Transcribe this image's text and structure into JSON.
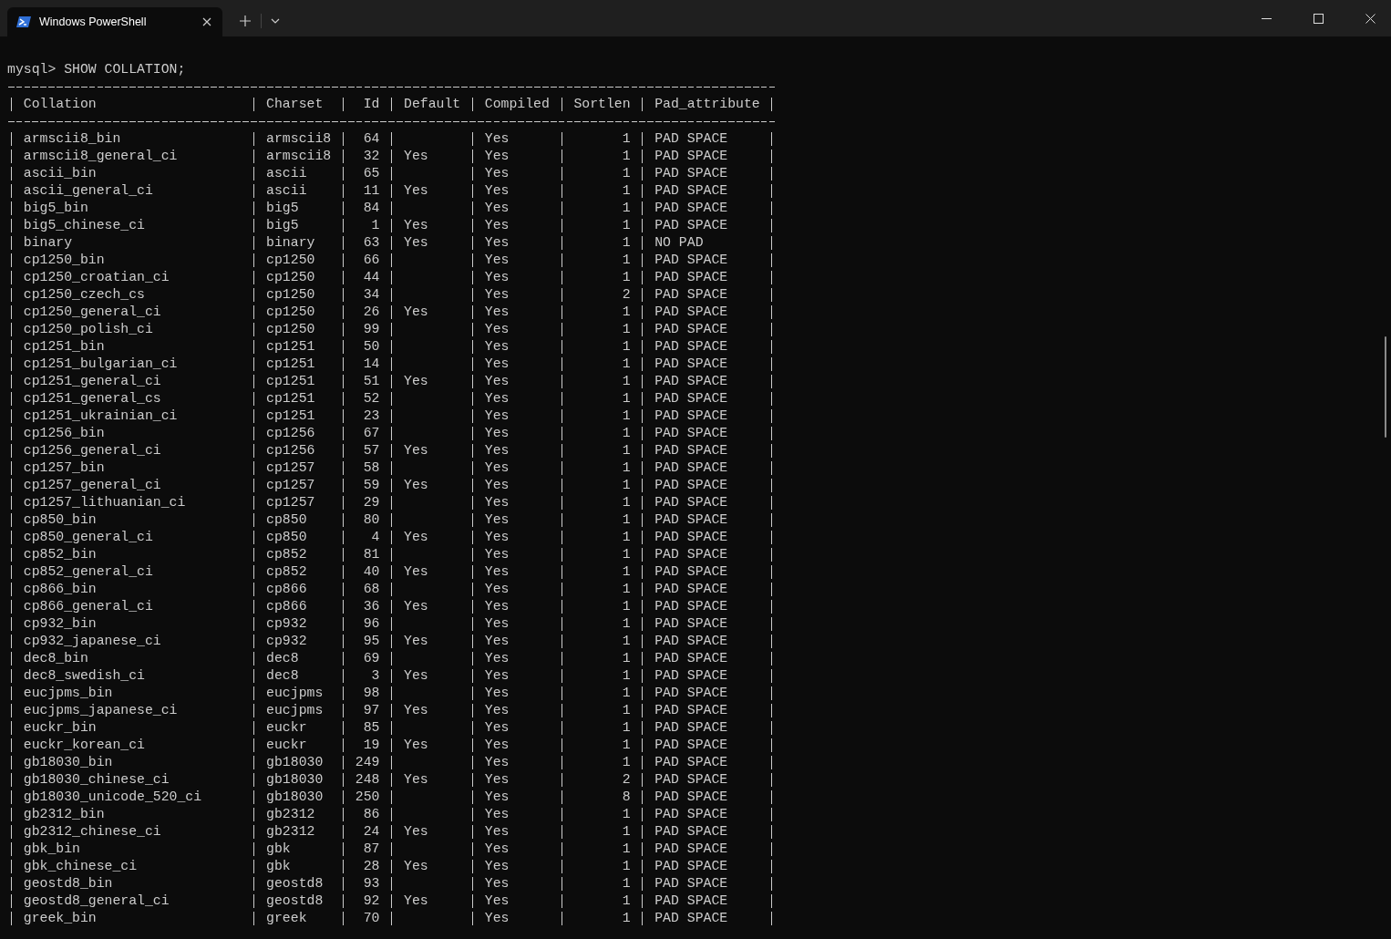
{
  "tab": {
    "title": "Windows PowerShell"
  },
  "terminal": {
    "prompt": "mysql> SHOW COLLATION;",
    "columns": [
      "Collation",
      "Charset",
      "Id",
      "Default",
      "Compiled",
      "Sortlen",
      "Pad_attribute"
    ],
    "rows": [
      [
        "armscii8_bin",
        "armscii8",
        "64",
        null,
        "Yes",
        "1",
        "PAD SPACE"
      ],
      [
        "armscii8_general_ci",
        "armscii8",
        "32",
        "Yes",
        "Yes",
        "1",
        "PAD SPACE"
      ],
      [
        "ascii_bin",
        "ascii",
        "65",
        null,
        "Yes",
        "1",
        "PAD SPACE"
      ],
      [
        "ascii_general_ci",
        "ascii",
        "11",
        "Yes",
        "Yes",
        "1",
        "PAD SPACE"
      ],
      [
        "big5_bin",
        "big5",
        "84",
        null,
        "Yes",
        "1",
        "PAD SPACE"
      ],
      [
        "big5_chinese_ci",
        "big5",
        "1",
        "Yes",
        "Yes",
        "1",
        "PAD SPACE"
      ],
      [
        "binary",
        "binary",
        "63",
        "Yes",
        "Yes",
        "1",
        "NO PAD"
      ],
      [
        "cp1250_bin",
        "cp1250",
        "66",
        null,
        "Yes",
        "1",
        "PAD SPACE"
      ],
      [
        "cp1250_croatian_ci",
        "cp1250",
        "44",
        null,
        "Yes",
        "1",
        "PAD SPACE"
      ],
      [
        "cp1250_czech_cs",
        "cp1250",
        "34",
        null,
        "Yes",
        "2",
        "PAD SPACE"
      ],
      [
        "cp1250_general_ci",
        "cp1250",
        "26",
        "Yes",
        "Yes",
        "1",
        "PAD SPACE"
      ],
      [
        "cp1250_polish_ci",
        "cp1250",
        "99",
        null,
        "Yes",
        "1",
        "PAD SPACE"
      ],
      [
        "cp1251_bin",
        "cp1251",
        "50",
        null,
        "Yes",
        "1",
        "PAD SPACE"
      ],
      [
        "cp1251_bulgarian_ci",
        "cp1251",
        "14",
        null,
        "Yes",
        "1",
        "PAD SPACE"
      ],
      [
        "cp1251_general_ci",
        "cp1251",
        "51",
        "Yes",
        "Yes",
        "1",
        "PAD SPACE"
      ],
      [
        "cp1251_general_cs",
        "cp1251",
        "52",
        null,
        "Yes",
        "1",
        "PAD SPACE"
      ],
      [
        "cp1251_ukrainian_ci",
        "cp1251",
        "23",
        null,
        "Yes",
        "1",
        "PAD SPACE"
      ],
      [
        "cp1256_bin",
        "cp1256",
        "67",
        null,
        "Yes",
        "1",
        "PAD SPACE"
      ],
      [
        "cp1256_general_ci",
        "cp1256",
        "57",
        "Yes",
        "Yes",
        "1",
        "PAD SPACE"
      ],
      [
        "cp1257_bin",
        "cp1257",
        "58",
        null,
        "Yes",
        "1",
        "PAD SPACE"
      ],
      [
        "cp1257_general_ci",
        "cp1257",
        "59",
        "Yes",
        "Yes",
        "1",
        "PAD SPACE"
      ],
      [
        "cp1257_lithuanian_ci",
        "cp1257",
        "29",
        null,
        "Yes",
        "1",
        "PAD SPACE"
      ],
      [
        "cp850_bin",
        "cp850",
        "80",
        null,
        "Yes",
        "1",
        "PAD SPACE"
      ],
      [
        "cp850_general_ci",
        "cp850",
        "4",
        "Yes",
        "Yes",
        "1",
        "PAD SPACE"
      ],
      [
        "cp852_bin",
        "cp852",
        "81",
        null,
        "Yes",
        "1",
        "PAD SPACE"
      ],
      [
        "cp852_general_ci",
        "cp852",
        "40",
        "Yes",
        "Yes",
        "1",
        "PAD SPACE"
      ],
      [
        "cp866_bin",
        "cp866",
        "68",
        null,
        "Yes",
        "1",
        "PAD SPACE"
      ],
      [
        "cp866_general_ci",
        "cp866",
        "36",
        "Yes",
        "Yes",
        "1",
        "PAD SPACE"
      ],
      [
        "cp932_bin",
        "cp932",
        "96",
        null,
        "Yes",
        "1",
        "PAD SPACE"
      ],
      [
        "cp932_japanese_ci",
        "cp932",
        "95",
        "Yes",
        "Yes",
        "1",
        "PAD SPACE"
      ],
      [
        "dec8_bin",
        "dec8",
        "69",
        null,
        "Yes",
        "1",
        "PAD SPACE"
      ],
      [
        "dec8_swedish_ci",
        "dec8",
        "3",
        "Yes",
        "Yes",
        "1",
        "PAD SPACE"
      ],
      [
        "eucjpms_bin",
        "eucjpms",
        "98",
        null,
        "Yes",
        "1",
        "PAD SPACE"
      ],
      [
        "eucjpms_japanese_ci",
        "eucjpms",
        "97",
        "Yes",
        "Yes",
        "1",
        "PAD SPACE"
      ],
      [
        "euckr_bin",
        "euckr",
        "85",
        null,
        "Yes",
        "1",
        "PAD SPACE"
      ],
      [
        "euckr_korean_ci",
        "euckr",
        "19",
        "Yes",
        "Yes",
        "1",
        "PAD SPACE"
      ],
      [
        "gb18030_bin",
        "gb18030",
        "249",
        null,
        "Yes",
        "1",
        "PAD SPACE"
      ],
      [
        "gb18030_chinese_ci",
        "gb18030",
        "248",
        "Yes",
        "Yes",
        "2",
        "PAD SPACE"
      ],
      [
        "gb18030_unicode_520_ci",
        "gb18030",
        "250",
        null,
        "Yes",
        "8",
        "PAD SPACE"
      ],
      [
        "gb2312_bin",
        "gb2312",
        "86",
        null,
        "Yes",
        "1",
        "PAD SPACE"
      ],
      [
        "gb2312_chinese_ci",
        "gb2312",
        "24",
        "Yes",
        "Yes",
        "1",
        "PAD SPACE"
      ],
      [
        "gbk_bin",
        "gbk",
        "87",
        null,
        "Yes",
        "1",
        "PAD SPACE"
      ],
      [
        "gbk_chinese_ci",
        "gbk",
        "28",
        "Yes",
        "Yes",
        "1",
        "PAD SPACE"
      ],
      [
        "geostd8_bin",
        "geostd8",
        "93",
        null,
        "Yes",
        "1",
        "PAD SPACE"
      ],
      [
        "geostd8_general_ci",
        "geostd8",
        "92",
        "Yes",
        "Yes",
        "1",
        "PAD SPACE"
      ],
      [
        "greek_bin",
        "greek",
        "70",
        null,
        "Yes",
        "1",
        "PAD SPACE"
      ]
    ]
  }
}
